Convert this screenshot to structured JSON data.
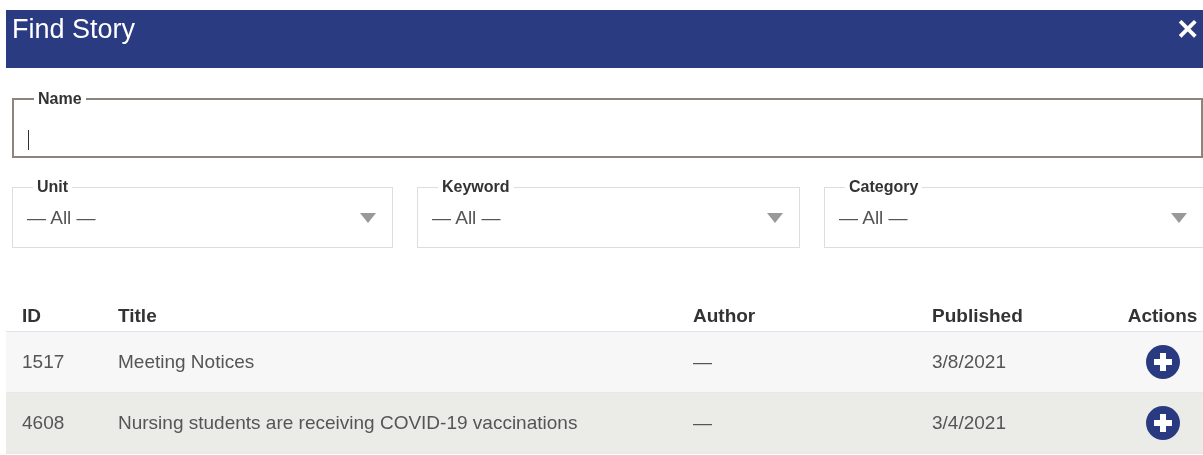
{
  "window": {
    "title": "Find Story",
    "close": "✕"
  },
  "name_field": {
    "label": "Name"
  },
  "filters": [
    {
      "label": "Unit",
      "value": "— All —"
    },
    {
      "label": "Keyword",
      "value": "— All —"
    },
    {
      "label": "Category",
      "value": "— All —"
    }
  ],
  "table": {
    "columns": [
      "ID",
      "Title",
      "Author",
      "Published",
      "Actions"
    ],
    "rows": [
      {
        "id": "1517",
        "title": "Meeting Notices",
        "author": "—",
        "published": "3/8/2021",
        "highlighted": false
      },
      {
        "id": "4608",
        "title": "Nursing students are receiving COVID-19 vaccinations",
        "author": "—",
        "published": "3/4/2021",
        "highlighted": true
      }
    ]
  }
}
